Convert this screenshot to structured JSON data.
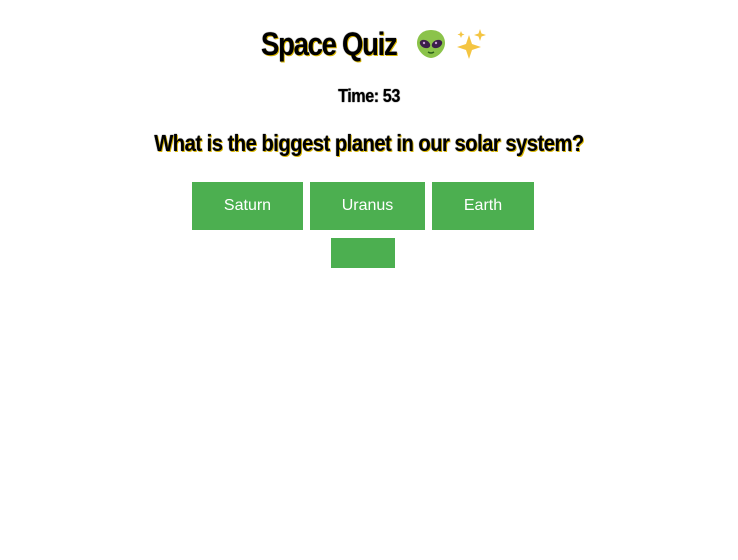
{
  "quiz": {
    "title": "Space Quiz",
    "title_icons": [
      "alien-icon",
      "sparkles-icon"
    ],
    "timer_label": "Time: 53",
    "question": "What is the biggest planet in our solar system?",
    "answers": [
      "Saturn",
      "Uranus",
      "Earth",
      ""
    ],
    "colors": {
      "button_bg": "#4caf50",
      "button_text": "#ffffff",
      "title_glow": "#d9b600"
    }
  }
}
